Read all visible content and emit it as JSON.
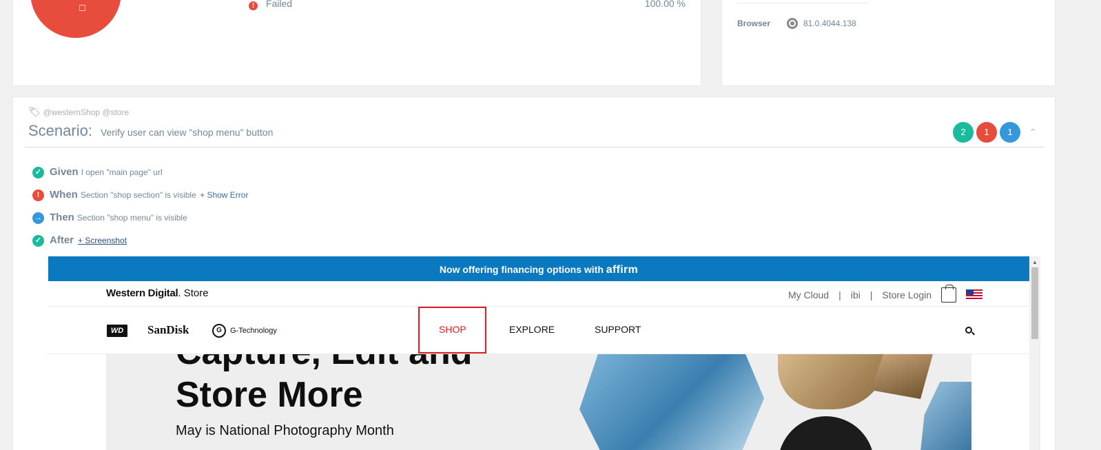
{
  "summary": {
    "status_label": "Failed",
    "status_percent": "100.00 %"
  },
  "meta": {
    "browser_label": "Browser",
    "browser_version": "81.0.4044.138",
    "browser_icon": "chrome-icon"
  },
  "scenario": {
    "tags": "@westernShop @store",
    "keyword": "Scenario:",
    "name": "Verify user can view \"shop menu\" button",
    "badges": {
      "passed": "2",
      "failed": "1",
      "skipped": "1"
    },
    "colors": {
      "passed": "#1abb9c",
      "failed": "#e74c3c",
      "skipped": "#3498db"
    },
    "steps": [
      {
        "keyword": "Given",
        "text": "I open \"main page\" url",
        "status": "passed",
        "icon": "check-circle-icon"
      },
      {
        "keyword": "When",
        "text": "Section \"shop section\" is visible",
        "link": "+ Show Error",
        "status": "failed",
        "icon": "exclamation-circle-icon"
      },
      {
        "keyword": "Then",
        "text": "Section \"shop menu\" is visible",
        "status": "skipped",
        "icon": "arrow-circle-right-icon"
      },
      {
        "keyword": "After",
        "link": "+ Screenshot",
        "status": "passed",
        "icon": "check-circle-icon"
      }
    ]
  },
  "screenshot": {
    "banner_text": "Now offering financing options with",
    "banner_brand": "affirm",
    "store_brand": "Western Digital",
    "store_suffix": ". Store",
    "top_links": [
      "My Cloud",
      "|",
      "ibi",
      "|",
      "Store Login"
    ],
    "brands": {
      "wd": "WD",
      "sandisk": "SanDisk",
      "gtech": "G-Technology"
    },
    "nav": [
      "SHOP",
      "EXPLORE",
      "SUPPORT"
    ],
    "hero_line1": "Capture, Edit and",
    "hero_line2": "Store More",
    "hero_sub": "May is National Photography Month"
  }
}
